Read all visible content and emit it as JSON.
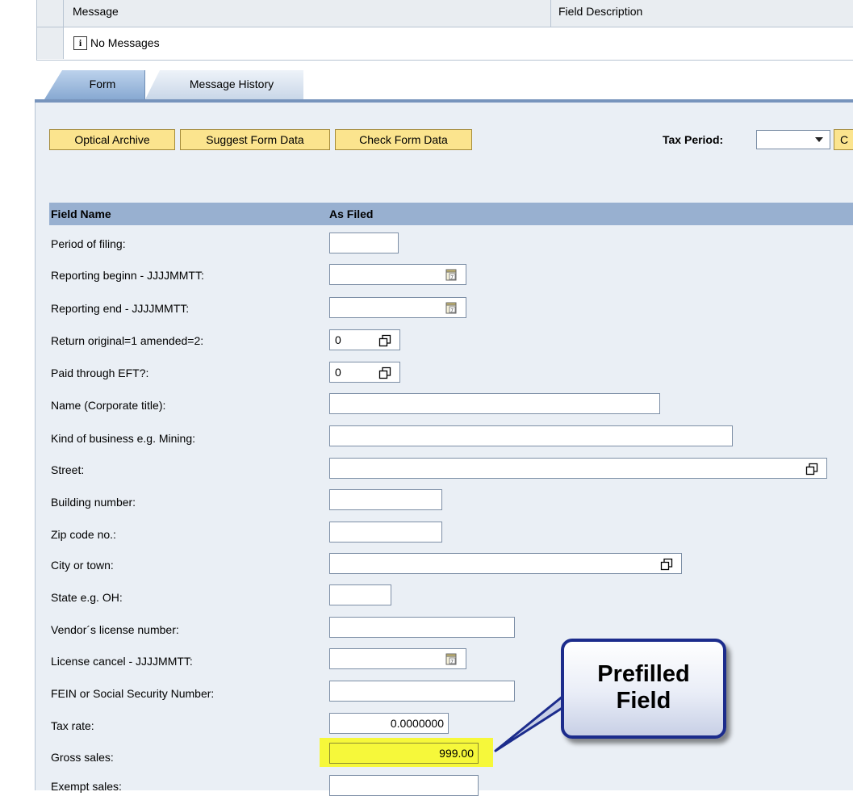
{
  "messages": {
    "column_message": "Message",
    "column_field_description": "Field Description",
    "row_text": "No Messages",
    "row_icon": "info-icon"
  },
  "tabs": [
    {
      "label": "Form",
      "selected": true
    },
    {
      "label": "Message History",
      "selected": false
    }
  ],
  "toolbar": {
    "optical_archive": "Optical Archive",
    "suggest_form_data": "Suggest Form Data",
    "check_form_data": "Check Form Data",
    "tax_period_label": "Tax Period:",
    "tax_period_value": "",
    "cut_button_label": "C"
  },
  "grid": {
    "header_field_name": "Field Name",
    "header_as_filed": "As Filed",
    "rows": [
      {
        "label": "Period of filing:",
        "value": ""
      },
      {
        "label": "Reporting beginn - JJJJMMTT:",
        "value": "",
        "icon": "calendar-icon"
      },
      {
        "label": "Reporting end - JJJJMMTT:",
        "value": "",
        "icon": "calendar-icon"
      },
      {
        "label": "Return original=1 amended=2:",
        "value": "0",
        "icon": "value-help-icon"
      },
      {
        "label": "Paid through EFT?:",
        "value": "0",
        "icon": "value-help-icon"
      },
      {
        "label": "Name (Corporate title):",
        "value": ""
      },
      {
        "label": "Kind of business e.g. Mining:",
        "value": ""
      },
      {
        "label": "Street:",
        "value": "",
        "icon": "value-help-icon"
      },
      {
        "label": "Building number:",
        "value": ""
      },
      {
        "label": "Zip code no.:",
        "value": ""
      },
      {
        "label": "City or town:",
        "value": "",
        "icon": "value-help-icon"
      },
      {
        "label": "State e.g. OH:",
        "value": ""
      },
      {
        "label": "Vendor´s license number:",
        "value": ""
      },
      {
        "label": "License cancel - JJJJMMTT:",
        "value": "",
        "icon": "calendar-icon"
      },
      {
        "label": "FEIN or Social Security Number:",
        "value": ""
      },
      {
        "label": "Tax rate:",
        "value": "0.0000000"
      },
      {
        "label": "Gross sales:",
        "value": "999.00",
        "highlighted": true
      },
      {
        "label": "Exempt sales:",
        "value": ""
      }
    ]
  },
  "callout": {
    "line1": "Prefilled",
    "line2": "Field"
  },
  "colors": {
    "highlight": "#f6f83a",
    "button": "#fbe48e",
    "grid_header": "#98b0d0",
    "callout_border": "#1c2c8c"
  }
}
